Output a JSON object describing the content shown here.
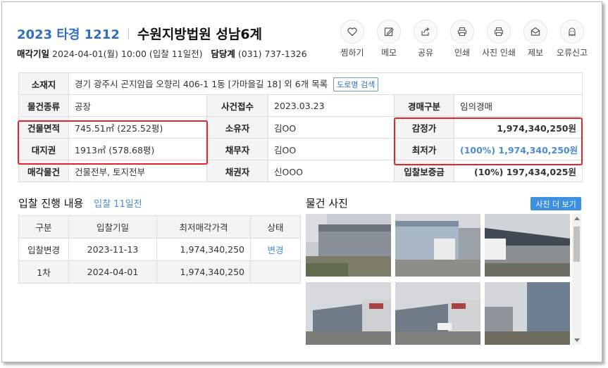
{
  "header": {
    "case_no": "2023 타경 1212",
    "court": "수원지방법원 성남6계",
    "sale_date_label": "매각기일",
    "sale_date_value": "2024-04-01(월) 10:00 (입찰 11일전)",
    "dept_label": "담당계",
    "dept_value": "(031) 737-1326"
  },
  "actions": [
    {
      "label": "찜하기",
      "icon": "heart-icon"
    },
    {
      "label": "메모",
      "icon": "memo-icon"
    },
    {
      "label": "공유",
      "icon": "share-icon"
    },
    {
      "label": "인쇄",
      "icon": "print-icon"
    },
    {
      "label": "사진 인쇄",
      "icon": "photo-print-icon"
    },
    {
      "label": "제보",
      "icon": "report-mail-icon"
    },
    {
      "label": "오류신고",
      "icon": "error-report-icon"
    }
  ],
  "info": {
    "location_label": "소재지",
    "location_value": "경기 광주시 곤지암읍 오향리 406-1 1동 [가마을길 18] 외 6개 목록",
    "road_button": "도로명 검색",
    "type_label": "물건종류",
    "type_value": "공장",
    "received_label": "사건접수",
    "received_value": "2023.03.23",
    "auction_type_label": "경매구분",
    "auction_type_value": "임의경매",
    "building_area_label": "건물면적",
    "building_area_value": "745.51㎡ (225.52평)",
    "owner_label": "소유자",
    "owner_value": "김OO",
    "appraisal_label": "감정가",
    "appraisal_value": "1,974,340,250원",
    "land_label": "대지권",
    "land_value": "1913㎡ (578.68평)",
    "debtor_label": "채무자",
    "debtor_value": "김OO",
    "min_price_label": "최저가",
    "min_price_value": "(100%) 1,974,340,250원",
    "sale_items_label": "매각물건",
    "sale_items_value": "건물전부, 토지전부",
    "creditor_label": "채권자",
    "creditor_value": "신OOO",
    "deposit_label": "입찰보증금",
    "deposit_value": "(10%) 197,434,025원"
  },
  "progress": {
    "title": "입찰 진행 내용",
    "subtitle": "입찰 11일전",
    "columns": [
      "구분",
      "입찰기일",
      "최저매각가격",
      "상태"
    ],
    "rows": [
      {
        "kind": "입찰변경",
        "date": "2023-11-13",
        "price": "1,974,340,250",
        "status": "변경"
      },
      {
        "kind": "1차",
        "date": "2024-04-01",
        "price": "1,974,340,250",
        "status": ""
      }
    ]
  },
  "photos": {
    "title": "물건 사진",
    "more_button": "사진 더 보기"
  },
  "colors": {
    "accent_blue": "#2f6fc0",
    "highlight_red": "#e0262b",
    "button_blue": "#3d8fe0"
  }
}
